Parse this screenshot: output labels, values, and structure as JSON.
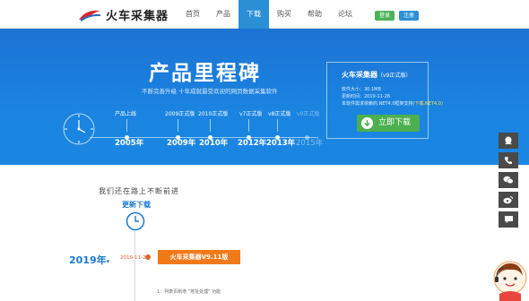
{
  "header": {
    "logo_text": "火车采集器",
    "nav": [
      "首页",
      "产品",
      "下载",
      "购买",
      "帮助",
      "论坛"
    ],
    "active_nav": 2,
    "login_label": "登录",
    "register_label": "注册"
  },
  "hero": {
    "title": "产品里程碑",
    "subtitle": "不断完善升级 十年成就最受欢迎的网页数据采集软件",
    "milestones": [
      {
        "label": "产品上线",
        "year": "2005年"
      },
      {
        "label": "2009正式版",
        "year": "2009年"
      },
      {
        "label": "2010正式版",
        "year": "2010年"
      },
      {
        "label": "v7正式版",
        "year": "2012年"
      },
      {
        "label": "v8正式版",
        "year": "2013年"
      },
      {
        "label": "v9正式版",
        "year": "2015年"
      }
    ]
  },
  "download_card": {
    "title": "火车采集器",
    "version": "（v9正式版）",
    "size": "软件大小：30.1MB",
    "updated": "更新时间：2019-11-26",
    "requirement": "本软件需求依赖的.NET4.0框架支持",
    "requirement_link": "(下载.NET4.0)",
    "button_label": "立即下载"
  },
  "side_widgets": [
    "qq-icon",
    "phone-icon",
    "wechat-icon",
    "weibo-icon",
    "chat-icon"
  ],
  "timeline": {
    "slogan": "我们还在路上不断前进",
    "update_label": "更新下载",
    "year": "2019年",
    "year_caret": "▾",
    "date": "2019-11-21",
    "version_tag": "火车采集器V9.11版",
    "note": "1：列表页新增 \"地址处理\" 功能"
  },
  "colors": {
    "brand_blue": "#2b8fd6",
    "hero_blue": "#1b7fdc",
    "green": "#4caf50",
    "orange": "#f07a1a"
  }
}
